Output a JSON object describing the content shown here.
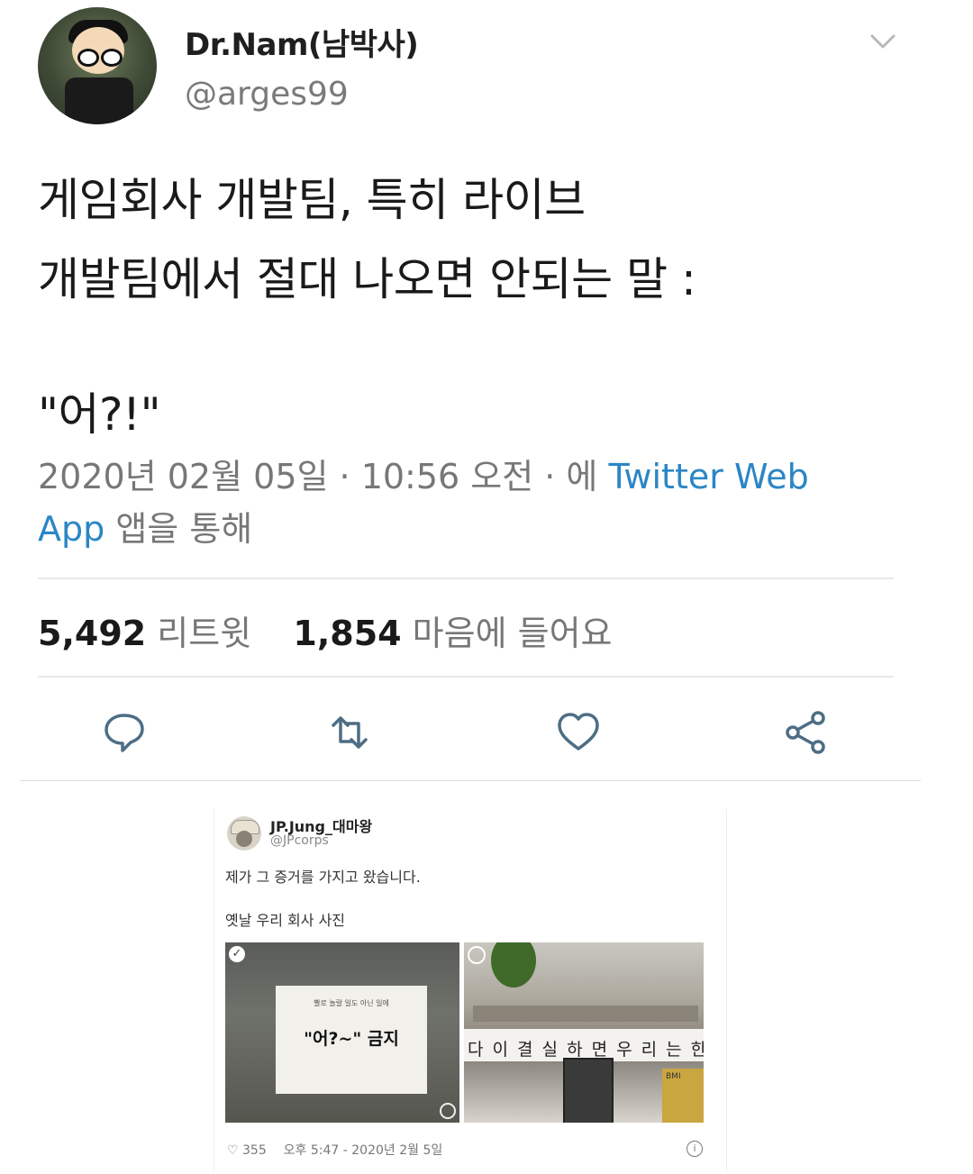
{
  "author": {
    "display_name": "Dr.Nam(남박사)",
    "handle": "@arges99",
    "avatar_icon": "cartoon-avatar"
  },
  "tweet": {
    "lines": [
      "게임회사 개발팀, 특히 라이브",
      "개발팀에서 절대 나오면 안되는 말 :",
      "",
      "\"어?!\""
    ]
  },
  "meta": {
    "timestamp": "2020년 02월 05일 · 10:56 오전 · 에",
    "source_link": "Twitter Web App",
    "source_suffix": "앱을 통해"
  },
  "stats": {
    "retweets_count": "5,492",
    "retweets_label": "리트윗",
    "likes_count": "1,854",
    "likes_label": "마음에 들어요"
  },
  "actions": {
    "icons": [
      "reply-icon",
      "retweet-icon",
      "like-icon",
      "share-icon"
    ]
  },
  "embedded": {
    "display_name": "JP.Jung_대마왕",
    "handle": "@JPcorps",
    "text_line1": "제가 그 증거를 가지고 왔습니다.",
    "text_line2": "옛날 우리 회사 사진",
    "photo1_small_text": "빨로 놀랄 일도 아닌 일에",
    "photo1_sign_text": "\"어?~\" 금지",
    "photo2_banner_text": "다 이 결 실 하 면 우 리 는 한 다",
    "photo2_box_text": "BMI",
    "footer_likes": "355",
    "footer_time": "오후 5:47 - 2020년 2월 5일",
    "info_glyph": "i"
  },
  "colors": {
    "link": "#2b86c5",
    "text": "#1a1a1a",
    "muted": "#777777",
    "divider": "#e8e8e8"
  }
}
